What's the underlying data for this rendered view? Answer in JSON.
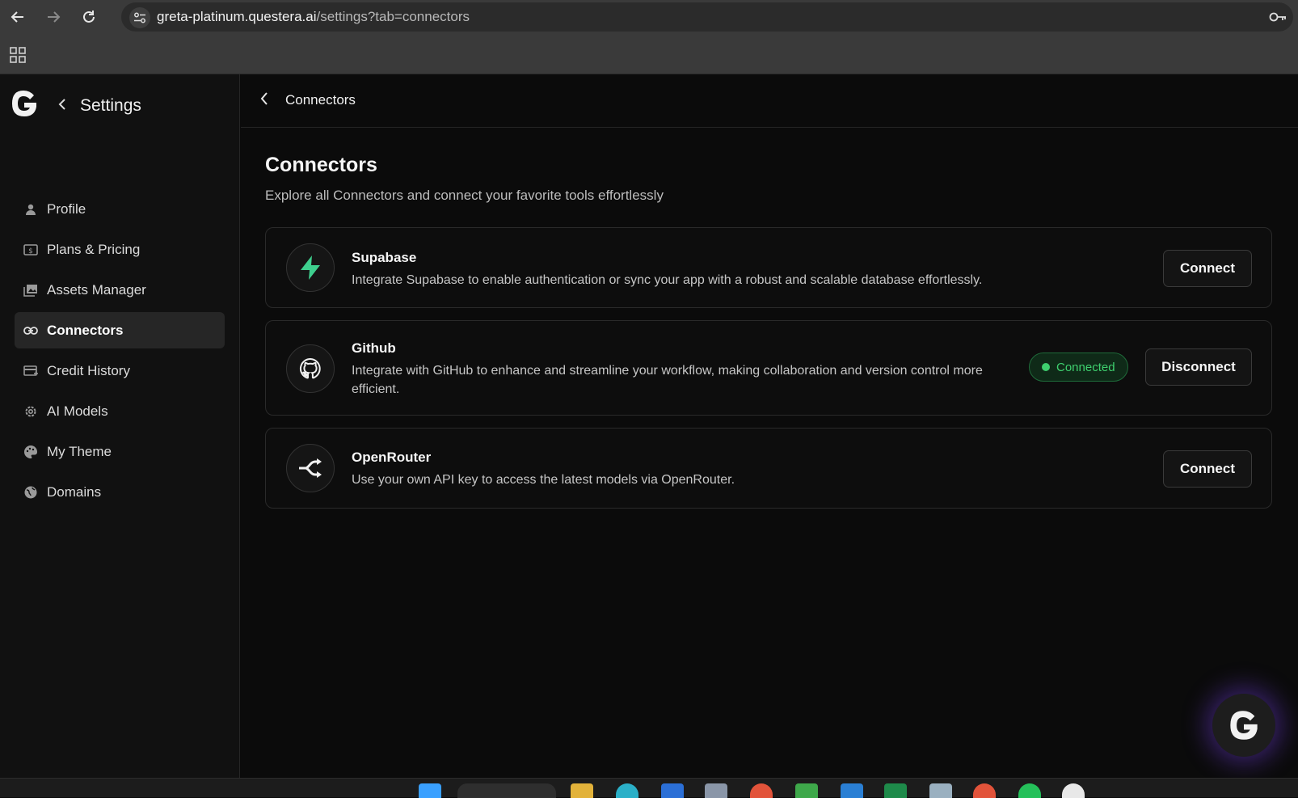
{
  "browser": {
    "url_host": "greta-platinum.questera.ai",
    "url_path": "/settings?tab=connectors"
  },
  "sidebar": {
    "title": "Settings",
    "items": [
      {
        "label": "Profile",
        "icon": "person-icon",
        "active": false
      },
      {
        "label": "Plans & Pricing",
        "icon": "dollar-bill-icon",
        "active": false
      },
      {
        "label": "Assets Manager",
        "icon": "image-gallery-icon",
        "active": false
      },
      {
        "label": "Connectors",
        "icon": "link-icon",
        "active": true
      },
      {
        "label": "Credit History",
        "icon": "credit-card-icon",
        "active": false
      },
      {
        "label": "AI Models",
        "icon": "gear-icon",
        "active": false
      },
      {
        "label": "My Theme",
        "icon": "palette-icon",
        "active": false
      },
      {
        "label": "Domains",
        "icon": "globe-icon",
        "active": false
      }
    ]
  },
  "header": {
    "breadcrumb": "Connectors"
  },
  "main": {
    "title": "Connectors",
    "subtitle": "Explore all Connectors and connect your favorite tools effortlessly"
  },
  "connectors": [
    {
      "name": "Supabase",
      "icon": "supabase-bolt-icon",
      "description": "Integrate Supabase to enable authentication or sync your app with a robust and scalable database effortlessly.",
      "action": "Connect"
    },
    {
      "name": "Github",
      "icon": "github-icon",
      "description": "Integrate with GitHub to enhance and streamline your workflow, making collaboration and version control more efficient.",
      "status": "Connected",
      "action": "Disconnect"
    },
    {
      "name": "OpenRouter",
      "icon": "openrouter-icon",
      "description": "Use your own API key to access the latest models via OpenRouter.",
      "action": "Connect"
    }
  ],
  "colors": {
    "accent_green": "#3ecf6e",
    "supabase_green": "#3ecf8e",
    "background": "#0b0b0b",
    "sidebar_active": "#262626",
    "fab_glow": "#6e3cdc"
  }
}
